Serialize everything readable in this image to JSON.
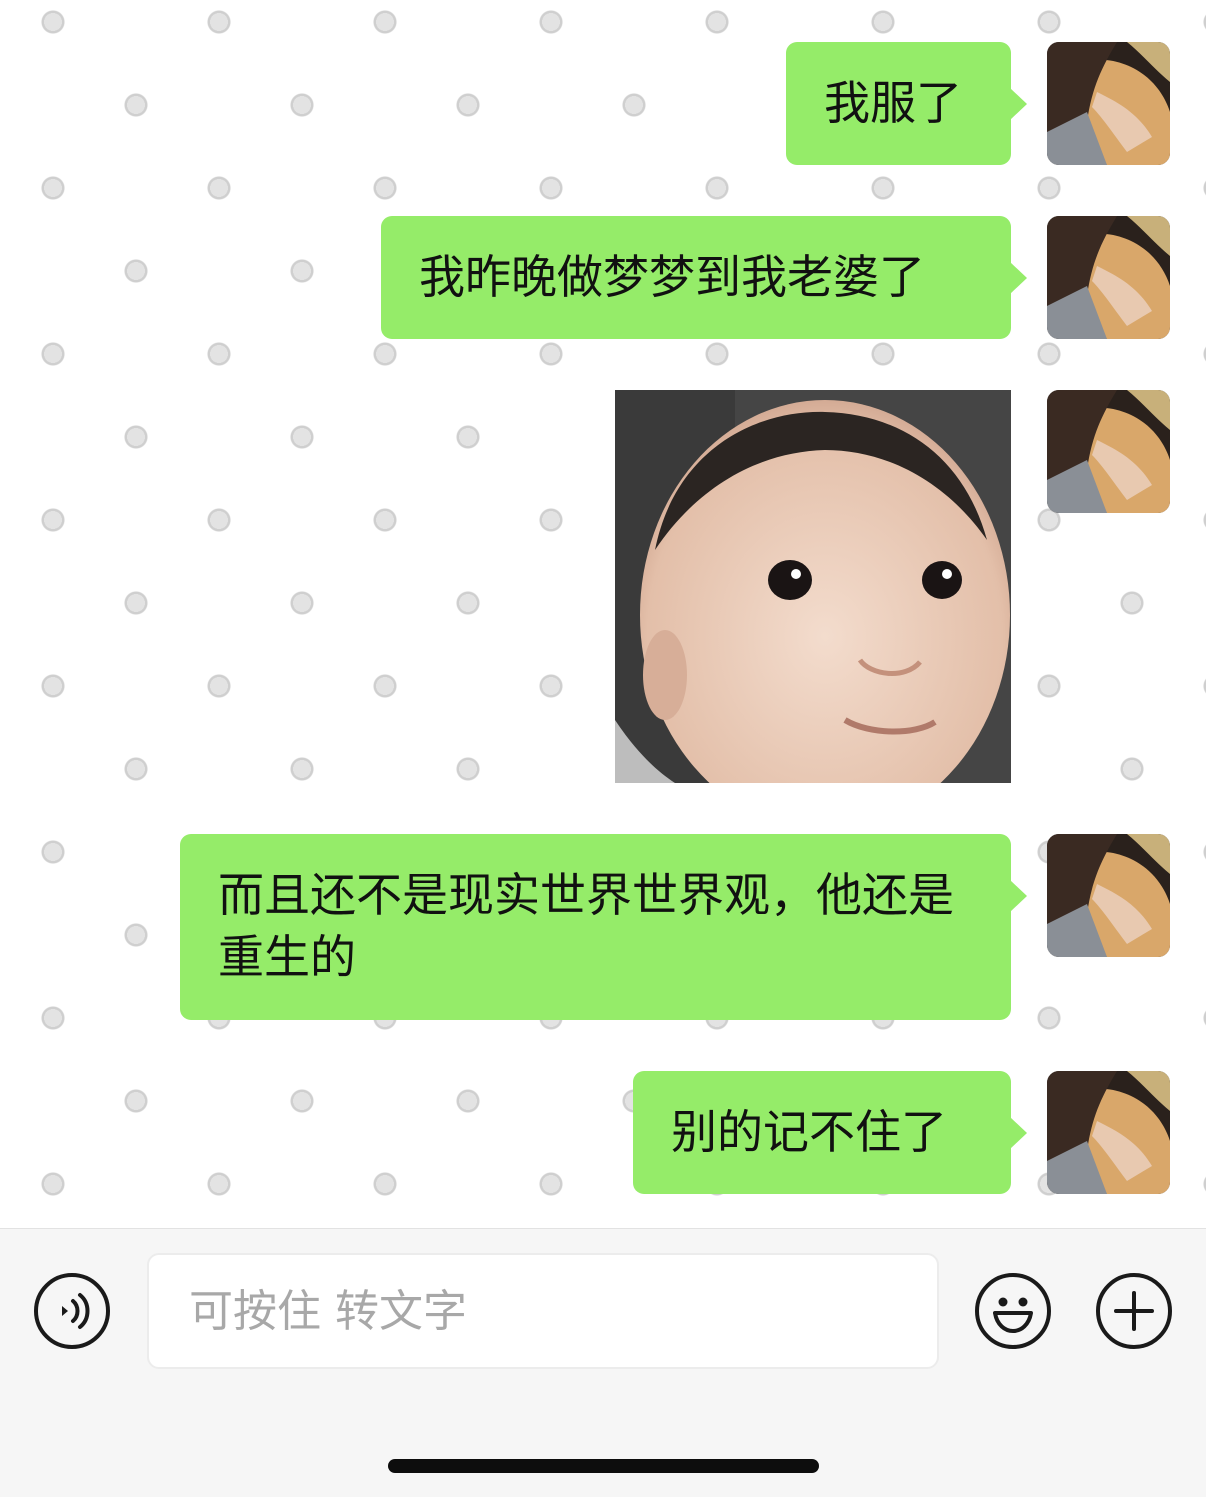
{
  "chat": {
    "messages": [
      {
        "type": "text",
        "text": "我服了"
      },
      {
        "type": "text",
        "text": "我昨晚做梦梦到我老婆了"
      },
      {
        "type": "image",
        "image": "baby-face-sticker"
      },
      {
        "type": "text",
        "text": "而且还不是现实世界世界观，他还是重生的"
      },
      {
        "type": "text",
        "text": "别的记不住了"
      }
    ]
  },
  "input_bar": {
    "placeholder": "可按住 转文字",
    "voice_icon": "voice-icon",
    "emoji_icon": "emoji-icon",
    "plus_icon": "plus-icon"
  },
  "colors": {
    "bubble_bg": "#95ec69",
    "chat_bg": "#ffffff",
    "input_bar_bg": "#f6f6f6"
  }
}
